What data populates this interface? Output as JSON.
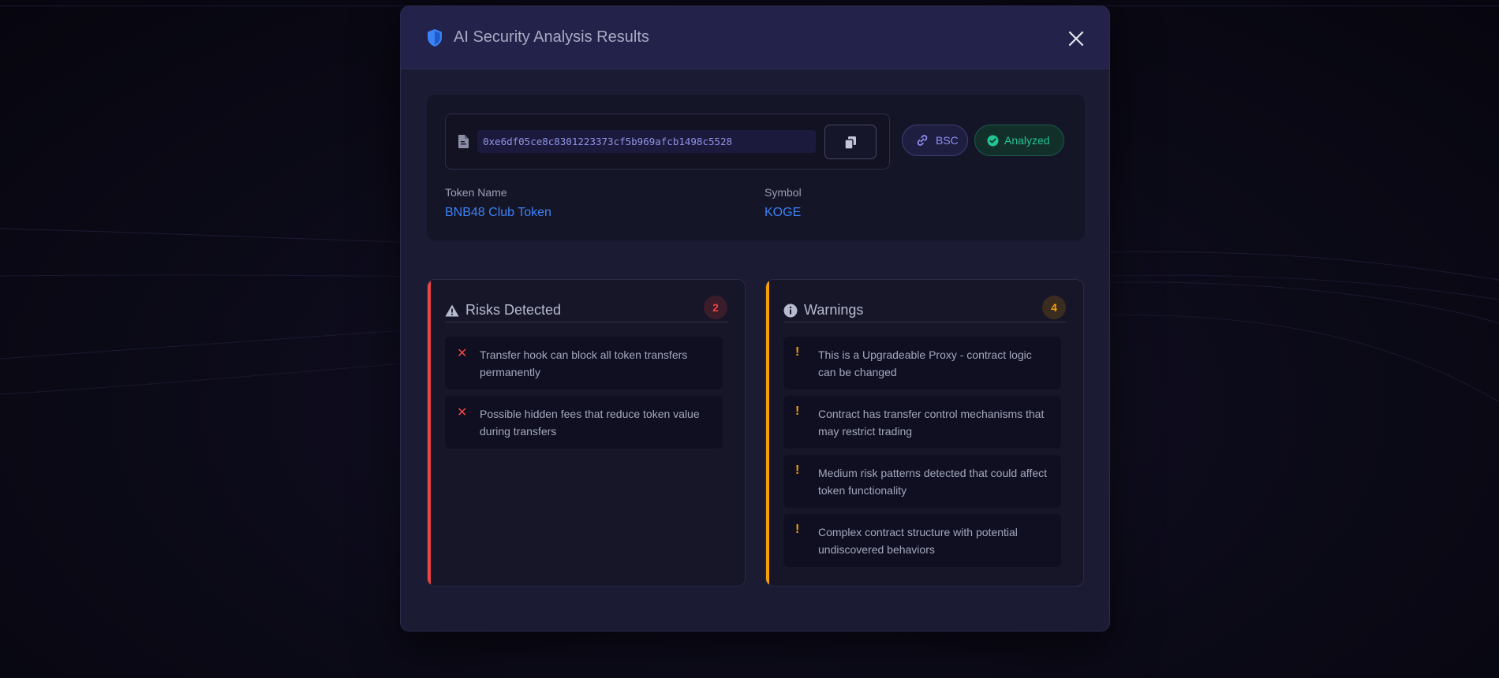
{
  "modal": {
    "title": "AI Security Analysis Results",
    "icons": {
      "title": "shield-check-icon",
      "close": "close-icon"
    }
  },
  "token": {
    "address": "0xe6df05ce8c8301223373cf5b969afcb1498c5528",
    "chain": "BSC",
    "status": "Analyzed",
    "name_label": "Token Name",
    "name": "BNB48 Club Token",
    "symbol_label": "Symbol",
    "symbol": "KOGE",
    "icons": {
      "address": "contract-file-icon",
      "copy": "copy-icon",
      "chain": "link-icon",
      "status": "check-circle-icon"
    }
  },
  "risks": {
    "title": "Risks Detected",
    "count": "2",
    "icon": "warning-triangle-icon",
    "item_icon": "x-mark-icon",
    "items": [
      "Transfer hook can block all token transfers permanently",
      "Possible hidden fees that reduce token value during transfers"
    ]
  },
  "warnings": {
    "title": "Warnings",
    "count": "4",
    "icon": "info-circle-icon",
    "item_icon": "exclamation-icon",
    "items": [
      "This is a Upgradeable Proxy - contract logic can be changed",
      "Contract has transfer control mechanisms that may restrict trading",
      "Medium risk patterns detected that could affect token functionality",
      "Complex contract structure with potential undiscovered behaviors"
    ]
  },
  "colors": {
    "accent_blue": "#3b82f6",
    "risk_red": "#ef4444",
    "warning_amber": "#f59e0b",
    "success_green": "#22c493",
    "chain_purple": "#8f8ff0"
  }
}
